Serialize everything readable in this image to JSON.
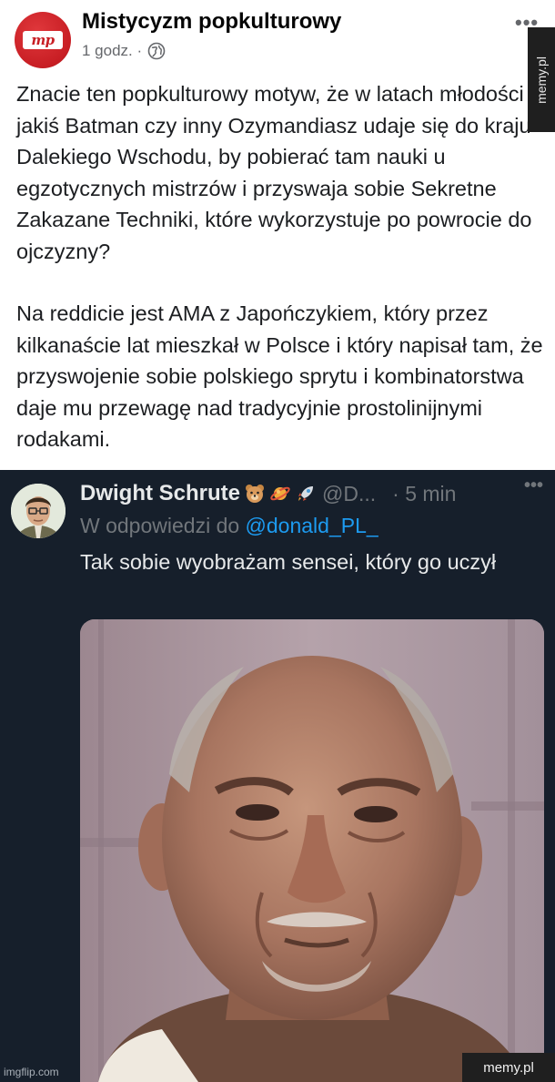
{
  "facebook_post": {
    "author": "Mistycyzm popkulturowy",
    "avatar_text": "mp",
    "timestamp": "1 godz. ·",
    "paragraphs": [
      "Znacie ten popkulturowy motyw, że w latach młodości jakiś Batman czy inny Ozymandiasz udaje się do kraju Dalekiego Wschodu, by pobierać tam nauki u egzotycznych mistrzów i przyswaja sobie Sekretne Zakazane Techniki, które wykorzystuje po powrocie do ojczyzny?",
      "Na reddicie jest AMA z Japończykiem, który przez kilkanaście lat mieszkał w Polsce i który napisał tam, że przyswojenie sobie polskiego sprytu i kombinatorstwa daje mu przewagę nad tradycyjnie prostolinijnymi rodakami."
    ],
    "more_label": "•••"
  },
  "tweet": {
    "name": "Dwight Schrute",
    "handle": "@D...",
    "time": "· 5 min",
    "reply_prefix": "W odpowiedzi do ",
    "reply_handle": "@donald_PL_",
    "text": "Tak sobie wyobrażam sensei, który go uczył",
    "emojis": [
      "bear-icon",
      "planet-icon",
      "rocket-icon"
    ],
    "more_label": "•••"
  },
  "watermarks": {
    "side": "memy.pl",
    "bottom": "memy.pl",
    "imgflip": "imgflip.com"
  },
  "colors": {
    "tweet_bg": "#161f2b",
    "link_blue": "#1d9bf0",
    "fb_brand_red": "#c81e24"
  }
}
